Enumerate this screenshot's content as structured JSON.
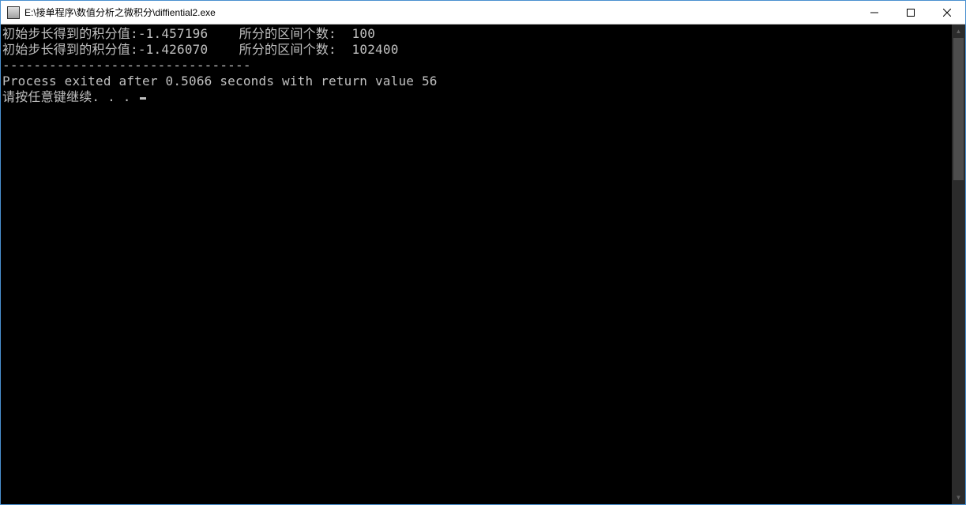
{
  "window": {
    "title": "E:\\接单程序\\数值分析之微积分\\diffiential2.exe"
  },
  "console": {
    "lines": [
      "初始步长得到的积分值:-1.457196    所分的区间个数:  100",
      "初始步长得到的积分值:-1.426070    所分的区间个数:  102400",
      "",
      "--------------------------------",
      "Process exited after 0.5066 seconds with return value 56"
    ],
    "prompt": "请按任意键继续. . . "
  }
}
